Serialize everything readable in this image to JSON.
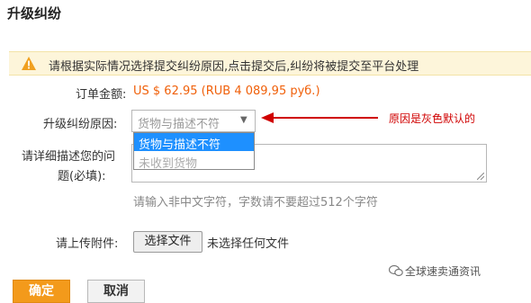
{
  "header": {
    "title": "升级纠纷"
  },
  "notice": {
    "icon": "warning-icon",
    "text": "请根据实际情况选择提交纠纷原因,点击提交后,纠纷将被提交至平台处理"
  },
  "order": {
    "amount_label": "订单金额:",
    "amount_value": "US $ 62.95 (RUB 4 089,95 руб.)"
  },
  "reason": {
    "label": "升级纠纷原因:",
    "selected": "货物与描述不符",
    "options": [
      "货物与描述不符",
      "未收到货物"
    ]
  },
  "annotation": {
    "text": "原因是灰色默认的"
  },
  "description": {
    "label_line1": "请详细描述您的问",
    "label_line2": "题(必填):",
    "hint": "请输入非中文字符，字数请不要超过512个字符"
  },
  "attachment": {
    "label": "请上传附件:",
    "button": "选择文件",
    "status": "未选择任何文件"
  },
  "actions": {
    "confirm": "确定",
    "cancel": "取消"
  },
  "watermark": {
    "text": "全球速卖通资讯"
  },
  "colors": {
    "amount": "#f0600a",
    "annotation": "#d00000",
    "confirm": "#f39a1b",
    "highlight": "#1e90ff"
  }
}
